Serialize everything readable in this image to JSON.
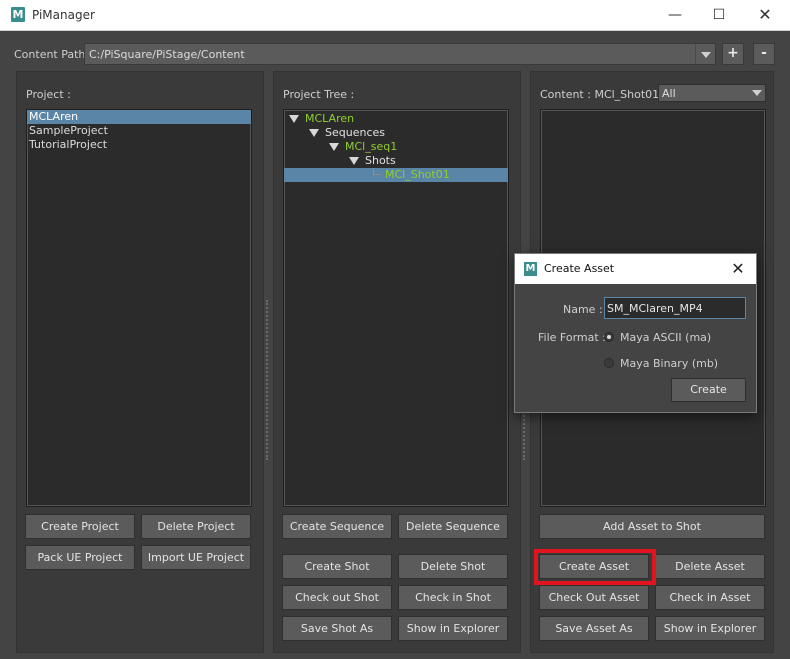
{
  "window": {
    "title": "PiManager",
    "icon_letter": "M",
    "minimize": "—",
    "maximize": "☐",
    "close": "✕"
  },
  "content_path": {
    "label": "Content Path:",
    "value": "C:/PiSquare/PiStage/Content",
    "add_label": "+",
    "remove_label": "-"
  },
  "project_panel": {
    "label": "Project :",
    "items": [
      "MCLAren",
      "SampleProject",
      "TutorialProject"
    ],
    "selected_index": 0,
    "buttons": {
      "create_project": "Create Project",
      "delete_project": "Delete Project",
      "pack_ue_project": "Pack UE Project",
      "import_ue_project": "Import UE Project"
    }
  },
  "tree_panel": {
    "label": "Project Tree :",
    "nodes": [
      {
        "text": "MCLAren",
        "depth": 0,
        "expanded": true
      },
      {
        "text": "Sequences",
        "depth": 1,
        "expanded": true
      },
      {
        "text": "MCl_seq1",
        "depth": 2,
        "expanded": true
      },
      {
        "text": "Shots",
        "depth": 3,
        "expanded": true
      },
      {
        "text": "MCl_Shot01",
        "depth": 4,
        "selected": true
      }
    ],
    "buttons": {
      "create_sequence": "Create Sequence",
      "delete_sequence": "Delete Sequence",
      "create_shot": "Create Shot",
      "delete_shot": "Delete Shot",
      "check_out_shot": "Check out Shot",
      "check_in_shot": "Check in Shot",
      "save_shot_as": "Save Shot As",
      "show_in_explorer": "Show in Explorer"
    }
  },
  "content_panel": {
    "label": "Content : MCl_Shot01",
    "filter_value": "All",
    "buttons": {
      "add_asset_to_shot": "Add Asset to Shot",
      "create_asset": "Create Asset",
      "delete_asset": "Delete Asset",
      "check_out_asset": "Check Out Asset",
      "check_in_asset": "Check in Asset",
      "save_asset_as": "Save Asset As",
      "show_in_explorer": "Show in Explorer"
    }
  },
  "create_asset_dialog": {
    "title": "Create Asset",
    "icon_letter": "M",
    "close": "✕",
    "name_label": "Name :",
    "name_value": "SM_MClaren_MP4",
    "file_format_label": "File Format :",
    "options": [
      "Maya ASCII (ma)",
      "Maya Binary (mb)"
    ],
    "selected_option": 0,
    "create_button": "Create"
  },
  "colors": {
    "selection": "#5a85a6",
    "tree_green": "#8fce2e",
    "highlight_red": "#e3141d"
  }
}
